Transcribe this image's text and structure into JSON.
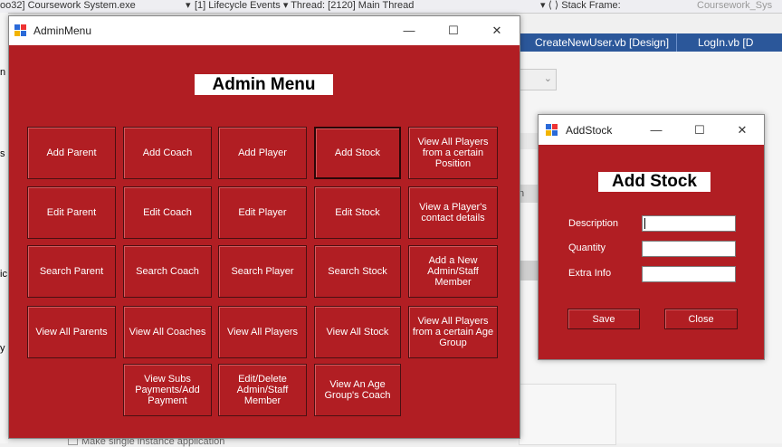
{
  "ide": {
    "top_texts": [
      "oo32] Coursework System.exe",
      "▾",
      "[1] Lifecycle Events ▾ Thread: [2120] Main Thread",
      "▾  ⟨  ⟩  Stack Frame:",
      "Coursework_Sys"
    ],
    "tabs": [
      "CreateNewUser.vb [Design]",
      "LogIn.vb [D"
    ],
    "bottom_checkbox_label": "Make single instance application",
    "edge_glyphs": [
      "n",
      "s",
      "ic",
      "y"
    ],
    "panel_letter": "n"
  },
  "admin_window": {
    "title": "AdminMenu",
    "heading": "Admin Menu",
    "controls": {
      "minimize": "—",
      "maximize": "☐",
      "close": "✕"
    },
    "buttons": [
      {
        "label": "Add Parent"
      },
      {
        "label": "Add Coach"
      },
      {
        "label": "Add Player"
      },
      {
        "label": "Add Stock"
      },
      {
        "label": "View All Players from a certain Position"
      },
      {
        "label": "Edit Parent"
      },
      {
        "label": "Edit Coach"
      },
      {
        "label": "Edit Player"
      },
      {
        "label": "Edit Stock"
      },
      {
        "label": "View a Player's contact details"
      },
      {
        "label": "Search Parent"
      },
      {
        "label": "Search Coach"
      },
      {
        "label": "Search Player"
      },
      {
        "label": "Search Stock"
      },
      {
        "label": "Add a New Admin/Staff Member"
      },
      {
        "label": "View All Parents"
      },
      {
        "label": "View All Coaches"
      },
      {
        "label": "View All Players"
      },
      {
        "label": "View All Stock"
      },
      {
        "label": "View All Players from a certain Age Group"
      },
      {
        "label": "View Subs Payments/Add Payment"
      },
      {
        "label": "Edit/Delete Admin/Staff Member"
      },
      {
        "label": "View An Age Group's Coach"
      }
    ]
  },
  "stock_window": {
    "title": "AddStock",
    "heading": "Add Stock",
    "controls": {
      "minimize": "—",
      "maximize": "☐",
      "close": "✕"
    },
    "fields": [
      {
        "label": "Description",
        "value": ""
      },
      {
        "label": "Quantity",
        "value": ""
      },
      {
        "label": "Extra Info",
        "value": ""
      }
    ],
    "save_label": "Save",
    "close_label": "Close"
  },
  "colors": {
    "form_red": "#b11e23",
    "ide_blue": "#2b579a"
  }
}
